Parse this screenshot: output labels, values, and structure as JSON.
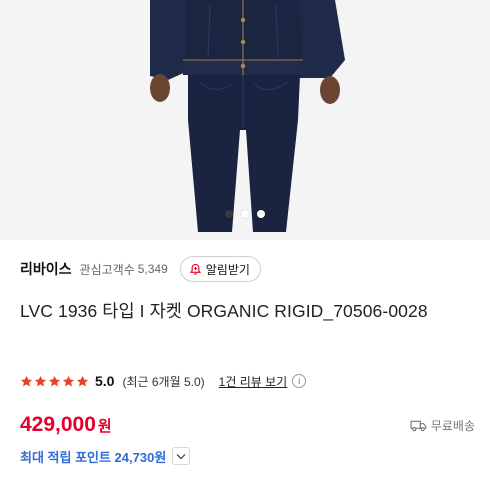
{
  "carousel": {
    "total_slides": 3,
    "active_index": 0
  },
  "brand": {
    "name": "리바이스",
    "fav_label": "관심고객수",
    "fav_count": "5,349",
    "alarm_button": "알림받기"
  },
  "product": {
    "title": "LVC 1936 타입 I 자켓 ORGANIC RIGID_70506-0028"
  },
  "rating": {
    "stars": 5,
    "score": "5.0",
    "recent": "(최근 6개월 5.0)",
    "review_link": "1건 리뷰 보기",
    "info_glyph": "i"
  },
  "price": {
    "amount": "429,000",
    "unit": "원"
  },
  "shipping": {
    "label": "무료배송"
  },
  "points": {
    "label": "최대 적립 포인트 24,730원"
  },
  "colors": {
    "price": "#e4002b",
    "points": "#2e6bd6",
    "star": "#e8412c",
    "denim": "#1c2540"
  },
  "icons": {
    "alarm": "bell-plus-icon",
    "info": "info-icon",
    "shipping": "truck-icon",
    "points_toggle": "chevron-down-icon",
    "star": "star-icon"
  }
}
